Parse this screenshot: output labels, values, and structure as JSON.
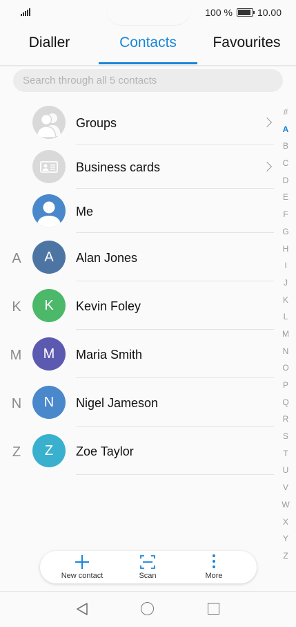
{
  "status": {
    "battery": "100 %",
    "time": "10.00"
  },
  "tabs": [
    {
      "label": "Dialler"
    },
    {
      "label": "Contacts"
    },
    {
      "label": "Favourites"
    }
  ],
  "search": {
    "placeholder": "Search through all 5 contacts"
  },
  "special_rows": [
    {
      "label": "Groups",
      "icon": "groups-icon"
    },
    {
      "label": "Business cards",
      "icon": "business-card-icon"
    },
    {
      "label": "Me",
      "icon": "person-icon"
    }
  ],
  "contacts": [
    {
      "section": "A",
      "initial": "A",
      "name": "Alan Jones",
      "color": "#4d75a3"
    },
    {
      "section": "K",
      "initial": "K",
      "name": "Kevin Foley",
      "color": "#4cb86a"
    },
    {
      "section": "M",
      "initial": "M",
      "name": "Maria Smith",
      "color": "#5c5ab0"
    },
    {
      "section": "N",
      "initial": "N",
      "name": "Nigel Jameson",
      "color": "#4a88cc"
    },
    {
      "section": "Z",
      "initial": "Z",
      "name": "Zoe Taylor",
      "color": "#3ab0cf"
    }
  ],
  "index": [
    "#",
    "A",
    "B",
    "C",
    "D",
    "E",
    "F",
    "G",
    "H",
    "I",
    "J",
    "K",
    "L",
    "M",
    "N",
    "O",
    "P",
    "Q",
    "R",
    "S",
    "T",
    "U",
    "V",
    "W",
    "X",
    "Y",
    "Z"
  ],
  "index_active": "A",
  "bottom": {
    "new_contact": "New contact",
    "scan": "Scan",
    "more": "More"
  },
  "colors": {
    "accent": "#1a86d9"
  }
}
